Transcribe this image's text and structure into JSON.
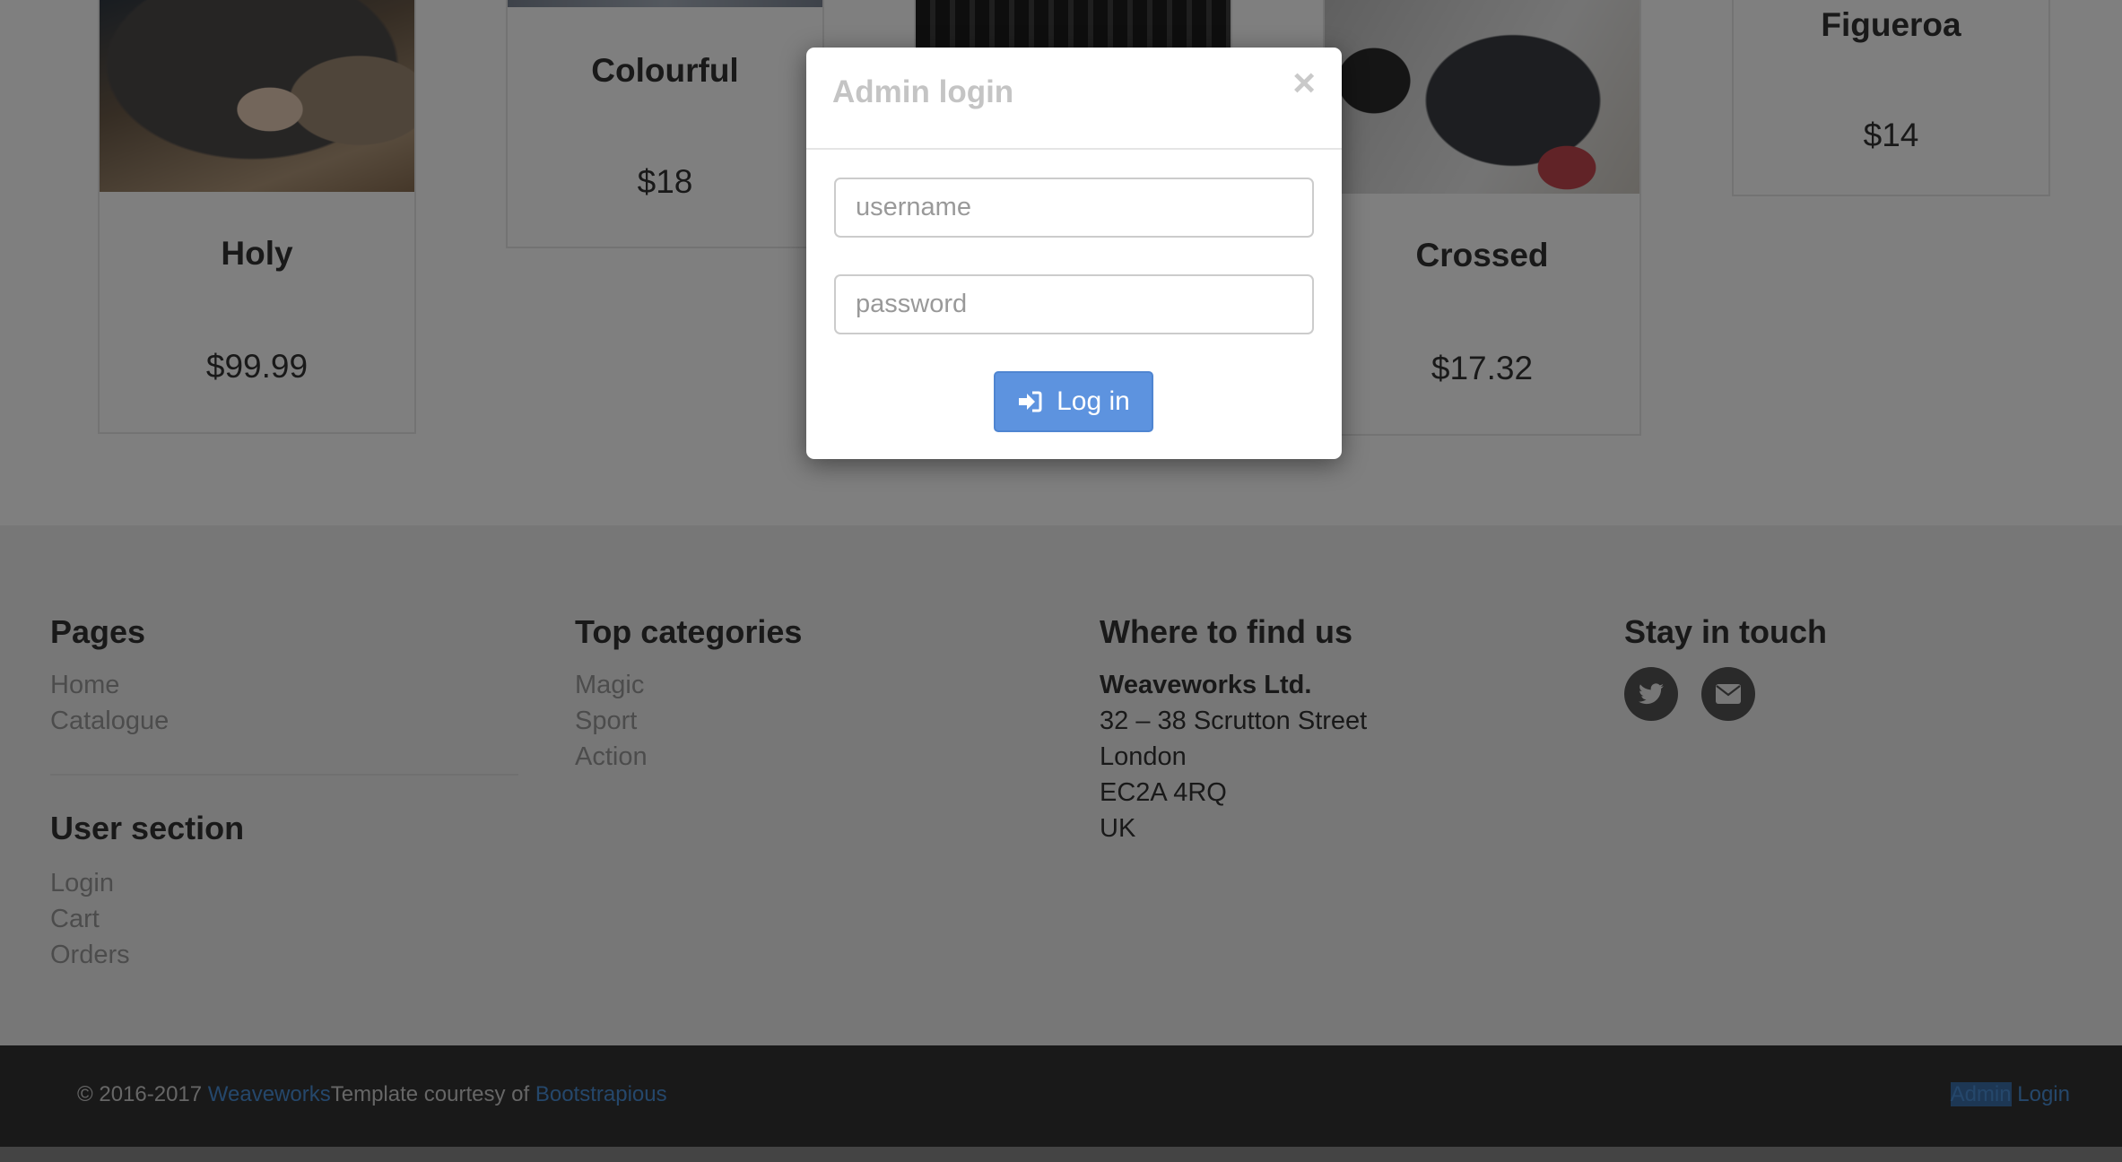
{
  "products": [
    {
      "name": "Holy",
      "price": "$99.99"
    },
    {
      "name": "Colourful",
      "price": "$18"
    },
    {
      "name": "Crossed",
      "price": "$17.32"
    },
    {
      "name": "Figueroa",
      "price": "$14"
    }
  ],
  "footer": {
    "pages": {
      "heading": "Pages",
      "links": [
        "Home",
        "Catalogue"
      ]
    },
    "user_section": {
      "heading": "User section",
      "links": [
        "Login",
        "Cart",
        "Orders"
      ]
    },
    "top_categories": {
      "heading": "Top categories",
      "links": [
        "Magic",
        "Sport",
        "Action"
      ]
    },
    "where": {
      "heading": "Where to find us",
      "company": "Weaveworks Ltd.",
      "address": [
        "32 – 38 Scrutton Street",
        "London",
        "EC2A 4RQ",
        "UK"
      ]
    },
    "stay": {
      "heading": "Stay in touch",
      "icons": [
        "twitter-icon",
        "envelope-icon"
      ]
    }
  },
  "copyright": {
    "prefix": "© 2016-2017 ",
    "company_link": "Weaveworks",
    "template_text": "Template courtesy of ",
    "template_link": "Bootstrapious",
    "admin_text": "Admin",
    "login_link": "Login"
  },
  "modal": {
    "title": "Admin login",
    "close_symbol": "×",
    "username_placeholder": "username",
    "password_placeholder": "password",
    "button_label": "Log in",
    "button_icon": "sign-in-icon"
  },
  "colors": {
    "button": "#5d93df",
    "link": "#4a8fd6",
    "overlay": "rgba(0,0,0,0.5)"
  }
}
